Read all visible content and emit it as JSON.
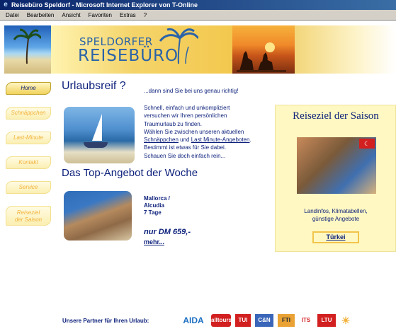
{
  "window": {
    "title": "Reisebüro Speldorf - Microsoft Internet Explorer von T-Online"
  },
  "menu": [
    "Datei",
    "Bearbeiten",
    "Ansicht",
    "Favoriten",
    "Extras",
    "?"
  ],
  "banner": {
    "logo_line1": "SPELDORFER",
    "logo_line2": "REISEBÜRO"
  },
  "nav": [
    {
      "label": "Home",
      "active": true
    },
    {
      "label": "Schnäppchen",
      "active": false
    },
    {
      "label": "Last-Minute",
      "active": false
    },
    {
      "label": "Kontakt",
      "active": false
    },
    {
      "label": "Service",
      "active": false
    },
    {
      "label_line1": "Reiseziel",
      "label_line2": "der Saison",
      "active": false
    }
  ],
  "main": {
    "heading": "Urlaubsreif ?",
    "tagline": "...dann sind Sie bei uns genau richtig!",
    "intro": {
      "line1": "Schnell, einfach und unkompliziert",
      "line2": "versuchen wir Ihren persönlichen",
      "line3": "Traumurlaub zu finden.",
      "line4": "Wählen Sie zwischen unseren aktuellen",
      "link1": "Schnäppchen",
      "and": " und ",
      "link2": "Last Minute-Angeboten",
      "dot": ".",
      "line6": "Bestimmt ist etwas für Sie dabei.",
      "line7": "Schauen Sie doch einfach rein..."
    },
    "offer_heading": "Das Top-Angebot der Woche",
    "offer": {
      "dest_line1": "Mallorca /",
      "dest_line2": "Alcudia",
      "dest_line3": "7 Tage",
      "price": "nur DM 659,-",
      "more": "mehr..."
    }
  },
  "panel": {
    "title": "Reiseziel der Saison",
    "desc_line1": "Landinfos, Klimatabellen,",
    "desc_line2": "günstige Angebote",
    "button": "Türkei"
  },
  "partners": {
    "label": "Unsere Partner für Ihren Urlaub:",
    "logos": [
      "AIDA",
      "alltours",
      "TUI",
      "C&N",
      "FTI",
      "ITS",
      "LTU",
      "☀"
    ]
  }
}
